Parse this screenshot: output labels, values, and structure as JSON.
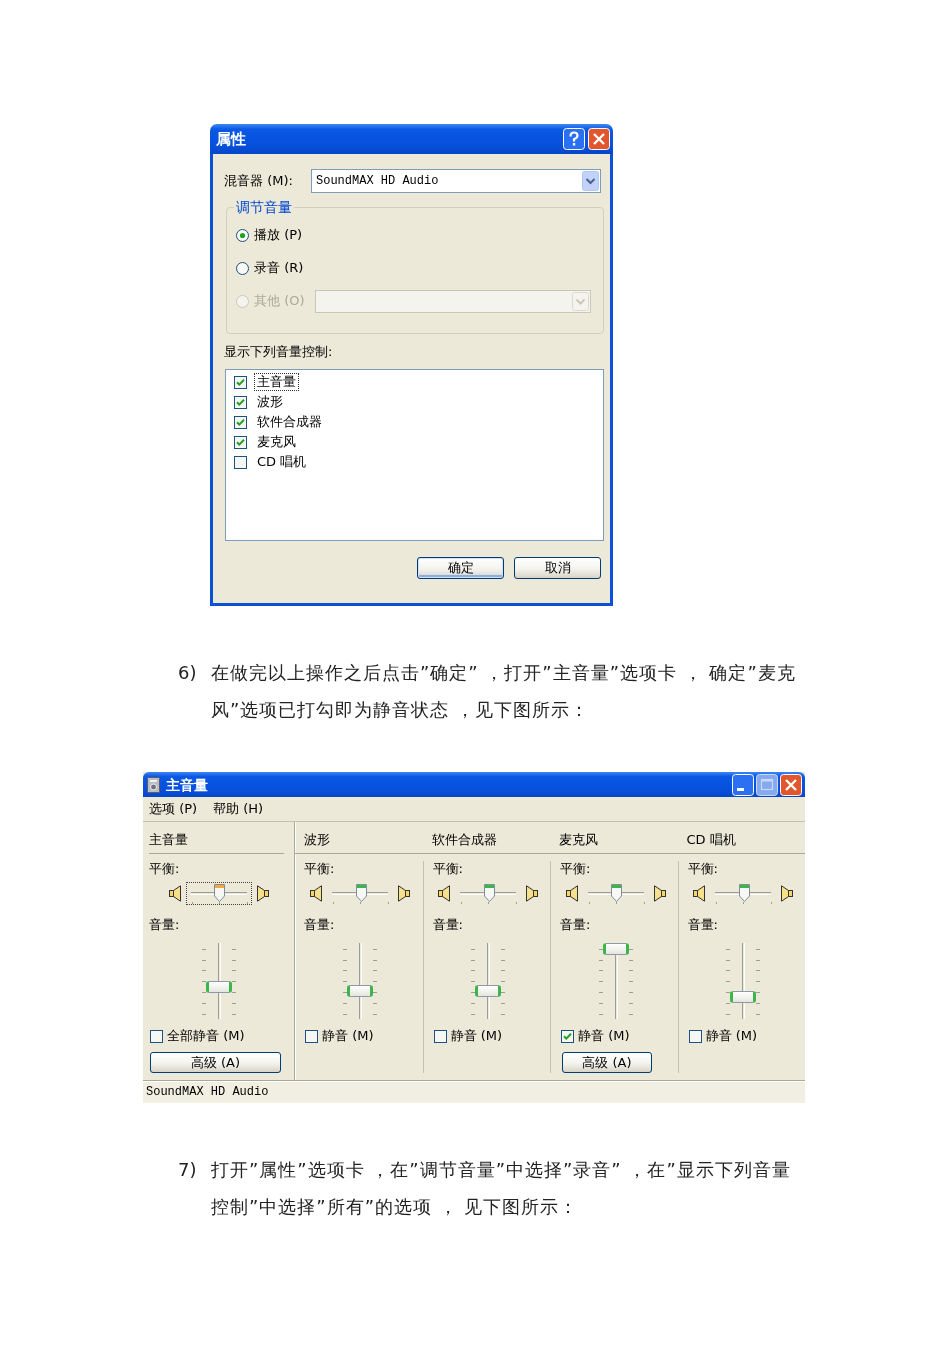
{
  "properties_dialog": {
    "title": "属性",
    "title_buttons": [
      {
        "kind": "help"
      },
      {
        "kind": "close"
      }
    ],
    "mixer": {
      "label": "混音器 (M):",
      "value": "SoundMAX HD Audio"
    },
    "volume_group": {
      "title": "调节音量",
      "options": [
        {
          "kind": "radio",
          "label": "播放 (P)",
          "selected": true,
          "disabled": false
        },
        {
          "kind": "radio",
          "label": "录音 (R)",
          "selected": false,
          "disabled": false
        },
        {
          "kind": "radio_with_dropdown",
          "label": "其他 (O)",
          "selected": false,
          "disabled": true
        }
      ]
    },
    "controls": {
      "label": "显示下列音量控制:",
      "items": [
        {
          "label": "主音量",
          "checked": true,
          "focused": true
        },
        {
          "label": "波形",
          "checked": true,
          "focused": false
        },
        {
          "label": "软件合成器",
          "checked": true,
          "focused": false
        },
        {
          "label": "麦克风",
          "checked": true,
          "focused": false
        },
        {
          "label": "CD 唱机",
          "checked": false,
          "focused": false
        }
      ]
    },
    "buttons": [
      {
        "label": "确定",
        "default": true
      },
      {
        "label": "取消",
        "default": false
      }
    ]
  },
  "step_6": {
    "number": "6)",
    "text": "在做完以上操作之后点击”确定” ，打开”主音量”选项卡 ， 确定”麦克风”选项已打勾即为静音状态 ，见下图所示："
  },
  "volume_window": {
    "title": "主音量",
    "title_buttons": [
      {
        "kind": "minimize",
        "disabled": false
      },
      {
        "kind": "maximize",
        "disabled": true
      },
      {
        "kind": "close",
        "disabled": false
      }
    ],
    "menu": [
      "选项 (P)",
      "帮助 (H)"
    ],
    "channels": [
      {
        "kind": "master",
        "name": "主音量",
        "balance": {
          "label": "平衡:",
          "level": 0.5,
          "focused": true
        },
        "volume": {
          "label": "音量:",
          "level": 0.4
        },
        "mute": {
          "label": "全部静音 (M)",
          "checked": false
        },
        "advanced_button": "高级 (A)"
      },
      {
        "kind": "channel",
        "name": "波形",
        "balance": {
          "label": "平衡:",
          "level": 0.5,
          "focused": false
        },
        "volume": {
          "label": "音量:",
          "level": 0.35
        },
        "mute": {
          "label": "静音 (M)",
          "checked": false
        }
      },
      {
        "kind": "channel",
        "name": "软件合成器",
        "balance": {
          "label": "平衡:",
          "level": 0.5,
          "focused": false
        },
        "volume": {
          "label": "音量:",
          "level": 0.35
        },
        "mute": {
          "label": "静音 (M)",
          "checked": false
        }
      },
      {
        "kind": "channel",
        "name": "麦克风",
        "balance": {
          "label": "平衡:",
          "level": 0.5,
          "focused": false
        },
        "volume": {
          "label": "音量:",
          "level": 1
        },
        "mute": {
          "label": "静音 (M)",
          "checked": true
        },
        "advanced_button": "高级 (A)"
      },
      {
        "kind": "channel",
        "name": "CD 唱机",
        "balance": {
          "label": "平衡:",
          "level": 0.5,
          "focused": false
        },
        "volume": {
          "label": "音量:",
          "level": 0.25
        },
        "mute": {
          "label": "静音 (M)",
          "checked": false
        }
      }
    ],
    "status_bar": "SoundMAX HD Audio"
  },
  "step_7": {
    "number": "7)",
    "text": "打开”属性”选项卡 ，在”调节音量”中选择”录音” ，在”显示下列音量控制”中选择”所有”的选项 ， 见下图所示："
  }
}
